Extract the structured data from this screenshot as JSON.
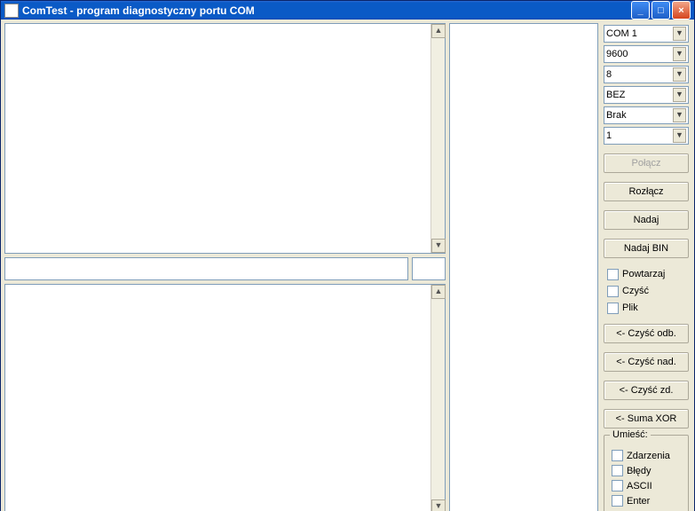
{
  "window": {
    "title": "ComTest - program diagnostyczny portu COM"
  },
  "combos": {
    "port": "COM 1",
    "baud": "9600",
    "databits": "8",
    "parity": "BEZ",
    "flow": "Brak",
    "stop": "1"
  },
  "buttons": {
    "connect": "Połącz",
    "disconnect": "Rozłącz",
    "send": "Nadaj",
    "sendbin": "Nadaj BIN",
    "clear_recv": "<- Czyść odb.",
    "clear_send": "<- Czyść nad.",
    "clear_ev": "<- Czyść zd.",
    "xor": "<- Suma XOR"
  },
  "checks": {
    "repeat": "Powtarzaj",
    "clear": "Czyść",
    "file": "Plik"
  },
  "group": {
    "legend": "Umieść:",
    "events": "Zdarzenia",
    "errors": "Błędy",
    "ascii": "ASCII",
    "enter": "Enter"
  }
}
